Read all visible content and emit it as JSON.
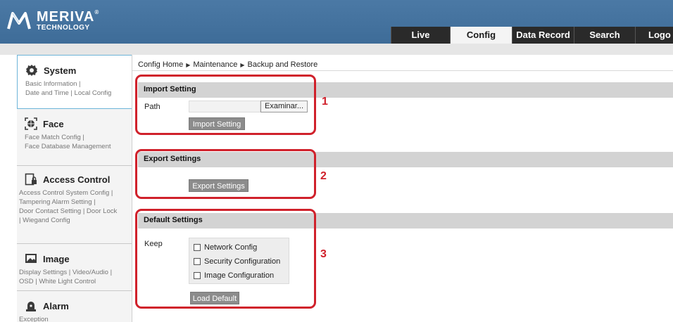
{
  "brand": {
    "name": "MERIVA",
    "reg": "®",
    "sub": "TECHNOLOGY"
  },
  "nav": {
    "tabs": [
      {
        "label": "Live",
        "active": false
      },
      {
        "label": "Config",
        "active": true
      },
      {
        "label": "Data Record",
        "active": false
      },
      {
        "label": "Search",
        "active": false
      },
      {
        "label": "Logo",
        "active": false
      }
    ]
  },
  "sidebar": {
    "sections": [
      {
        "title": "System",
        "icon": "gear-icon",
        "links": [
          "Basic Information |",
          "Date and Time | Local Config"
        ]
      },
      {
        "title": "Face",
        "icon": "face-scan-icon",
        "links": [
          "Face Match Config |",
          "Face Database Management"
        ]
      },
      {
        "title": "Access Control",
        "icon": "door-lock-icon",
        "links": [
          "Access Control System Config |",
          "Tampering Alarm Setting |",
          "Door Contact Setting | Door Lock",
          " | Wiegand Config"
        ]
      },
      {
        "title": "Image",
        "icon": "image-icon",
        "links": [
          "Display Settings | Video/Audio |",
          "OSD | White Light Control"
        ]
      },
      {
        "title": "Alarm",
        "icon": "alarm-icon",
        "links": [
          "Exception"
        ]
      }
    ]
  },
  "breadcrumb": {
    "home": "Config Home",
    "level1": "Maintenance",
    "level2": "Backup and Restore",
    "separator": "▶"
  },
  "import_section": {
    "title": "Import Setting",
    "path_label": "Path",
    "browse_label": "Examinar...",
    "button_label": "Import Setting"
  },
  "export_section": {
    "title": "Export Settings",
    "button_label": "Export Settings"
  },
  "default_section": {
    "title": "Default Settings",
    "keep_label": "Keep",
    "options": [
      {
        "label": "Network Config",
        "checked": false
      },
      {
        "label": "Security Configuration",
        "checked": false
      },
      {
        "label": "Image Configuration",
        "checked": false
      }
    ],
    "button_label": "Load Default"
  },
  "annotations": [
    "1",
    "2",
    "3"
  ],
  "colors": {
    "header": "#4674a0",
    "annotation": "#d0212b",
    "active_border": "#6cb4d8"
  }
}
